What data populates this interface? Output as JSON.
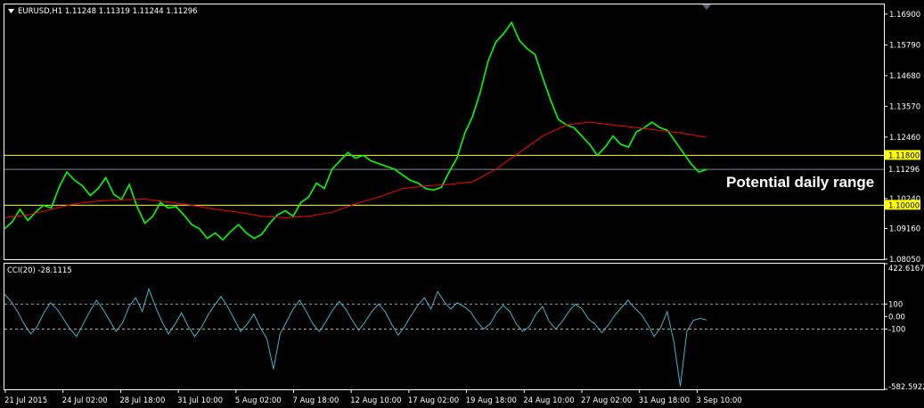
{
  "chart_data": [
    {
      "type": "line",
      "window": "main",
      "symbol_info": "EURUSD,H1  1.11248 1.11319 1.11244 1.11296",
      "y_range": [
        1.0805,
        1.1725
      ],
      "y_ticks": [
        "1.16900",
        "1.15790",
        "1.14680",
        "1.13570",
        "1.12460",
        "1.10240",
        "1.09160",
        "1.08050"
      ],
      "x_ticks": [
        "21 Jul 2015",
        "24 Jul 02:00",
        "28 Jul 18:00",
        "31 Jul 10:00",
        "5 Aug 02:00",
        "7 Aug 18:00",
        "12 Aug 10:00",
        "17 Aug 02:00",
        "19 Aug 18:00",
        "24 Aug 10:00",
        "27 Aug 02:00",
        "31 Aug 18:00",
        "3 Sep 10:00"
      ],
      "series": [
        {
          "color": "#00ff00",
          "values": [
            1.0915,
            1.094,
            1.0985,
            1.0945,
            1.0975,
            1.1,
            1.099,
            1.1065,
            1.112,
            1.109,
            1.107,
            1.1035,
            1.106,
            1.11,
            1.104,
            1.102,
            1.1075,
            1.0995,
            1.0935,
            1.096,
            1.101,
            1.099,
            1.0995,
            1.0965,
            1.093,
            1.0915,
            1.088,
            1.09,
            1.0875,
            1.0905,
            1.093,
            1.09,
            1.088,
            1.0895,
            1.0935,
            1.0965,
            1.098,
            1.096,
            1.101,
            1.103,
            1.108,
            1.106,
            1.113,
            1.116,
            1.119,
            1.117,
            1.118,
            1.116,
            1.115,
            1.114,
            1.113,
            1.111,
            1.109,
            1.108,
            1.106,
            1.1055,
            1.1065,
            1.112,
            1.117,
            1.126,
            1.132,
            1.141,
            1.152,
            1.159,
            1.162,
            1.166,
            1.1595,
            1.1565,
            1.1545,
            1.146,
            1.138,
            1.131,
            1.129,
            1.128,
            1.125,
            1.122,
            1.118,
            1.121,
            1.125,
            1.122,
            1.121,
            1.1265,
            1.128,
            1.13,
            1.128,
            1.127,
            1.123,
            1.119,
            1.115,
            1.112,
            1.1129
          ]
        },
        {
          "color": "#ff0000",
          "values": [
            1.0955,
            1.0965,
            1.0985,
            1.1005,
            1.1015,
            1.102,
            1.1022,
            1.1012,
            1.1,
            1.0985,
            1.0975,
            1.096,
            1.0955,
            1.096,
            1.0975,
            1.1005,
            1.103,
            1.106,
            1.107,
            1.1075,
            1.1085,
            1.113,
            1.119,
            1.125,
            1.129,
            1.13,
            1.129,
            1.128,
            1.127,
            1.126,
            1.1245
          ]
        }
      ],
      "price_lines": [
        {
          "price": 1.118,
          "label": "1.11800",
          "color": "#ffff00"
        },
        {
          "price": 1.1,
          "label": "1.10000",
          "color": "#ffff00"
        },
        {
          "price": 1.11296,
          "label": "1.11296",
          "color": "#778899"
        }
      ],
      "annotations": [
        "Potential daily range"
      ]
    },
    {
      "type": "line",
      "window": "indicator",
      "title": "CCI(20) -28.1115",
      "y_range": [
        -582.5922,
        422.6167
      ],
      "y_ticks": [
        "422.6167",
        "100",
        "0.00",
        "-100",
        "-582.5922"
      ],
      "levels": [
        100,
        -100
      ],
      "series": [
        {
          "color": "#3fb6c8",
          "values": [
            180,
            120,
            40,
            -60,
            -140,
            -80,
            30,
            110,
            60,
            -20,
            -100,
            -160,
            -60,
            40,
            130,
            60,
            -30,
            -120,
            -50,
            80,
            150,
            40,
            220,
            80,
            -40,
            -140,
            -60,
            30,
            -80,
            -160,
            -90,
            10,
            90,
            160,
            80,
            -20,
            -120,
            -60,
            20,
            -90,
            -180,
            -420,
            -140,
            -40,
            60,
            130,
            40,
            -60,
            -120,
            -40,
            50,
            120,
            60,
            -30,
            -110,
            -40,
            40,
            100,
            40,
            -60,
            -150,
            -80,
            10,
            90,
            150,
            60,
            200,
            120,
            60,
            110,
            80,
            40,
            -40,
            -100,
            -60,
            30,
            90,
            40,
            -60,
            -120,
            -80,
            20,
            80,
            -40,
            -100,
            -40,
            40,
            100,
            60,
            -20,
            -60,
            -130,
            -70,
            10,
            70,
            130,
            70,
            20,
            -60,
            -160,
            -90,
            40,
            -200,
            -560,
            -120,
            -30,
            -15,
            -28
          ]
        }
      ]
    }
  ]
}
